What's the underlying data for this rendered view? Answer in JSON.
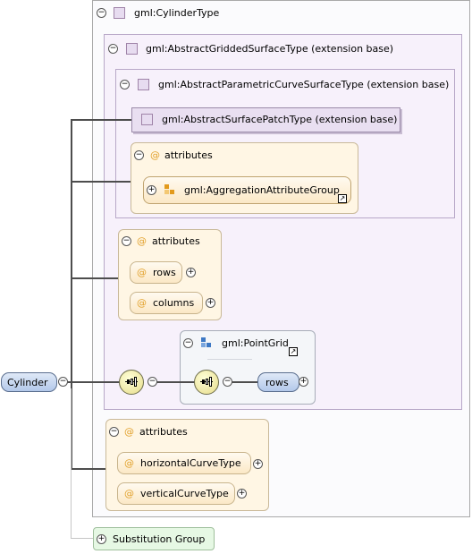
{
  "root": {
    "label": "Cylinder",
    "toggle": "−"
  },
  "cylinder_type": {
    "label": "gml:CylinderType",
    "toggle": "−"
  },
  "gridded_surface": {
    "label": "gml:AbstractGriddedSurfaceType (extension base)",
    "toggle": "−"
  },
  "parametric_curve_surface": {
    "label": "gml:AbstractParametricCurveSurfaceType (extension base)",
    "toggle": "−"
  },
  "surface_patch": {
    "label": "gml:AbstractSurfacePatchType (extension base)"
  },
  "attributes_inner": {
    "at": "@",
    "label": "attributes",
    "toggle": "−",
    "group": {
      "label": "gml:AggregationAttributeGroup",
      "toggle": "+"
    }
  },
  "attributes_grid": {
    "at": "@",
    "label": "attributes",
    "toggle": "−",
    "items": [
      {
        "label": "rows",
        "expand": "+"
      },
      {
        "label": "columns",
        "expand": "+"
      }
    ]
  },
  "sequence": {
    "toggle": "−",
    "point_grid": {
      "label": "gml:PointGrid",
      "toggle": "−",
      "inner_toggle": "−",
      "rows": {
        "label": "rows",
        "expand": "+"
      }
    }
  },
  "attributes_cylinder": {
    "at": "@",
    "label": "attributes",
    "toggle": "−",
    "items": [
      {
        "label": "horizontalCurveType",
        "expand": "+"
      },
      {
        "label": "verticalCurveType",
        "expand": "+"
      }
    ]
  },
  "substitution_group": {
    "label": "Substitution Group",
    "toggle": "+"
  },
  "colors": {
    "purple_fill": "#f7f1fb",
    "attribute_fill": "#fff6e4",
    "element_blue": "#b3c8ea",
    "at_sign": "#e2a12c",
    "substitution_green": "#e6f8e4"
  },
  "icons": [
    "class-square-icon",
    "at-sign-icon",
    "attribute-group-icon",
    "sequence-compositor-icon",
    "shortcut-arrow-icon"
  ]
}
